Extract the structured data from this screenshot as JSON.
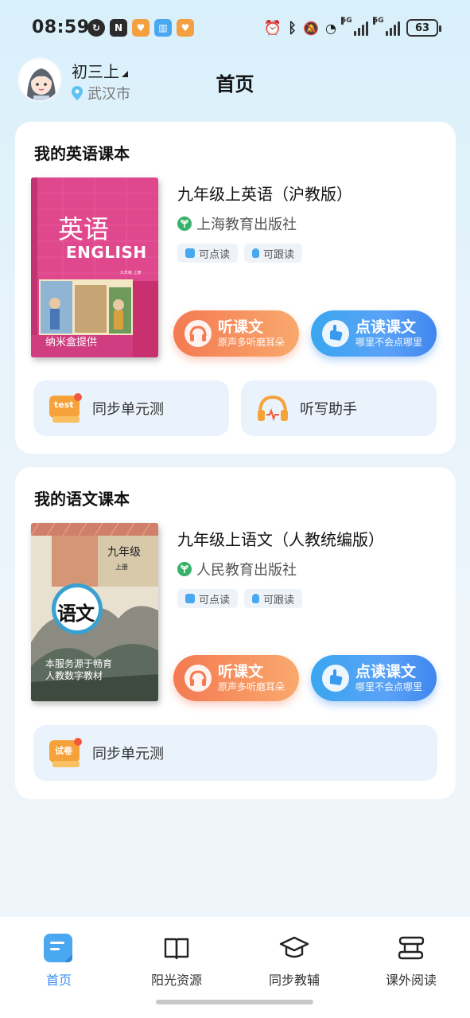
{
  "status_bar": {
    "time": "08:59",
    "battery": "63",
    "signal_label": "5G"
  },
  "header": {
    "grade": "初三上",
    "city": "武汉市",
    "title": "首页"
  },
  "english_card": {
    "section_title": "我的英语课本",
    "book_name": "九年级上英语（沪教版）",
    "publisher": "上海教育出版社",
    "tags": [
      "可点读",
      "可跟读"
    ],
    "cover": {
      "title_cn": "英语",
      "title_en": "ENGLISH",
      "grade_small": "九年级  上册",
      "provider": "纳米盒提供"
    },
    "listen_button": {
      "label": "听课文",
      "sub": "原声多听磨耳朵"
    },
    "read_button": {
      "label": "点读课文",
      "sub": "哪里不会点哪里"
    },
    "tools": [
      {
        "label": "同步单元测",
        "icon_text": "test"
      },
      {
        "label": "听写助手"
      }
    ]
  },
  "chinese_card": {
    "section_title": "我的语文课本",
    "book_name": "九年级上语文（人教统编版）",
    "publisher": "人民教育出版社",
    "tags": [
      "可点读",
      "可跟读"
    ],
    "cover": {
      "grade": "九年级",
      "volume": "上册",
      "title": "语文",
      "notice": "本服务源于畅育人教数字教材"
    },
    "listen_button": {
      "label": "听课文",
      "sub": "原声多听磨耳朵"
    },
    "read_button": {
      "label": "点读课文",
      "sub": "哪里不会点哪里"
    },
    "tools": [
      {
        "label": "同步单元测",
        "icon_text": "试卷"
      }
    ]
  },
  "bottom_nav": [
    {
      "label": "首页",
      "icon": "home-doc-icon",
      "active": true
    },
    {
      "label": "阳光资源",
      "icon": "open-book-icon",
      "active": false
    },
    {
      "label": "同步教辅",
      "icon": "graduation-cap-icon",
      "active": false
    },
    {
      "label": "课外阅读",
      "icon": "scroll-icon",
      "active": false
    }
  ],
  "colors": {
    "accent_blue": "#3a8ff0",
    "listen_orange": "#f47a52",
    "card_bg": "#ffffff",
    "tool_bg": "#eaf3fc"
  }
}
